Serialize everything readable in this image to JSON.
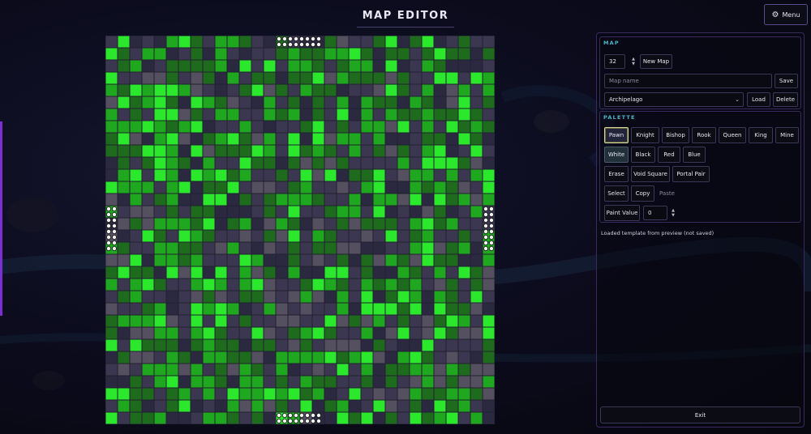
{
  "header": {
    "title": "MAP EDITOR",
    "menu_label": "Menu",
    "menu_icon": "gear-icon"
  },
  "map_section": {
    "title": "MAP",
    "size_value": "32",
    "new_map_label": "New Map",
    "name_placeholder": "Map name",
    "save_label": "Save",
    "template_selected": "Archipelago",
    "load_label": "Load",
    "delete_label": "Delete"
  },
  "palette_section": {
    "title": "PALETTE",
    "pieces": [
      "Pawn",
      "Knight",
      "Bishop",
      "Rook",
      "Queen",
      "King",
      "Mine"
    ],
    "colors": [
      "White",
      "Black",
      "Red",
      "Blue"
    ],
    "tools": [
      "Erase",
      "Void Square",
      "Portal Pair"
    ],
    "clipboard": [
      "Select",
      "Copy",
      "Paste"
    ],
    "paint_value_label": "Paint Value",
    "paint_value": "0",
    "selected_piece": "Pawn",
    "selected_color": "White"
  },
  "status_text": "Loaded template from preview (not saved)",
  "exit_label": "Exit",
  "board": {
    "size": 32,
    "colors": {
      "void": "#3c3750",
      "dark_void": "#2b2940",
      "green_dark": "#1e6b1e",
      "green_mid": "#1fa81f",
      "green_bright": "#2ce82c",
      "gray": "#55505f"
    }
  }
}
